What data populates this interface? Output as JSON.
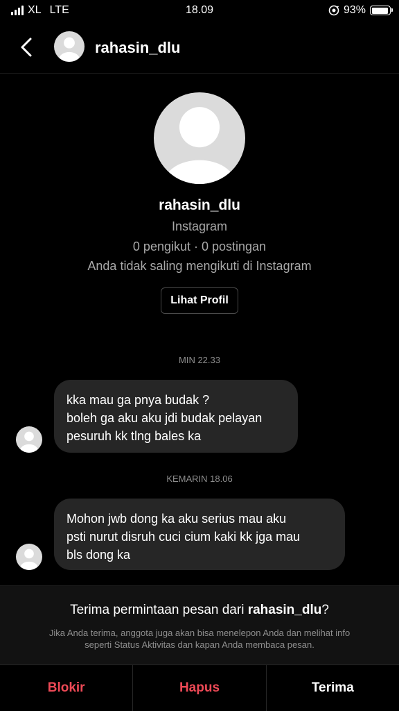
{
  "status_bar": {
    "carrier": "XL",
    "network": "LTE",
    "time": "18.09",
    "battery_percent": "93%",
    "battery_level": 0.93
  },
  "header": {
    "username": "rahasin_dlu"
  },
  "profile": {
    "name": "rahasin_dlu",
    "platform": "Instagram",
    "stats": "0 pengikut · 0 postingan",
    "relation": "Anda tidak saling mengikuti di Instagram",
    "view_profile_label": "Lihat Profil"
  },
  "messages": [
    {
      "timestamp": "MIN 22.33",
      "lines": [
        "kka mau ga pnya budak ?",
        "boleh ga aku aku jdi budak pelayan",
        "pesuruh kk tlng bales ka"
      ]
    },
    {
      "timestamp": "KEMARIN 18.06",
      "lines": [
        "Mohon jwb dong ka aku serius mau aku",
        "psti nurut disruh cuci cium kaki kk jga mau",
        "bls dong ka"
      ]
    }
  ],
  "request": {
    "title_prefix": "Terima permintaan pesan dari ",
    "title_user": "rahasin_dlu",
    "title_suffix": "?",
    "subtitle_line1": "Jika Anda terima, anggota juga akan bisa menelepon Anda dan melihat info",
    "subtitle_line2": "seperti Status Aktivitas dan kapan Anda membaca pesan."
  },
  "actions": {
    "block": "Blokir",
    "delete": "Hapus",
    "accept": "Terima"
  },
  "colors": {
    "destructive": "#ed4956",
    "bubble": "#262626",
    "avatar_bg": "#dbdbdb"
  },
  "icons": [
    "signal-icon",
    "location-icon",
    "battery-icon",
    "back-chevron-icon",
    "default-avatar-icon"
  ]
}
